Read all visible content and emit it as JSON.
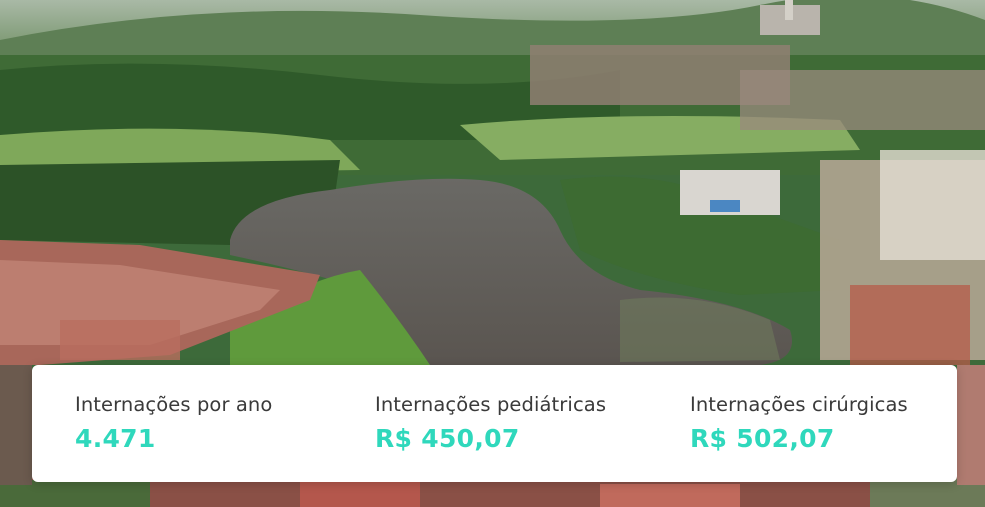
{
  "stats": [
    {
      "label": "Internações por ano",
      "value": "4.471"
    },
    {
      "label": "Internações pediátricas",
      "value": "R$ 450,07"
    },
    {
      "label": "Internações cirúrgicas",
      "value": "R$ 502,07"
    }
  ],
  "colors": {
    "accent": "#2fd8bc",
    "label": "#3a3a3a",
    "card": "#ffffff"
  }
}
